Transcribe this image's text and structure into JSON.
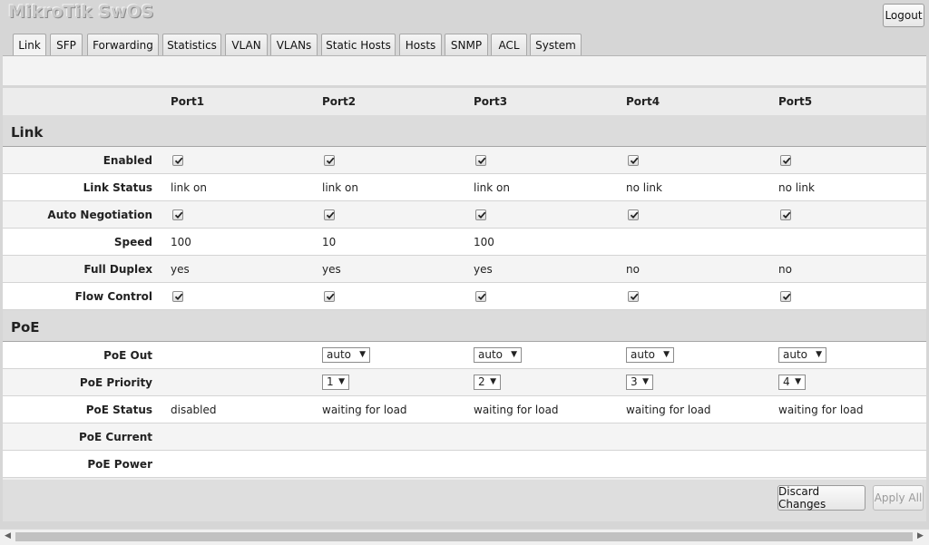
{
  "brand": "MikroTik SwOS",
  "logout_label": "Logout",
  "tabs": [
    "Link",
    "SFP",
    "Forwarding",
    "Statistics",
    "VLAN",
    "VLANs",
    "Static Hosts",
    "Hosts",
    "SNMP",
    "ACL",
    "System"
  ],
  "active_tab": "Link",
  "ports": [
    "Port1",
    "Port2",
    "Port3",
    "Port4",
    "Port5"
  ],
  "sections": {
    "link": "Link",
    "poe": "PoE"
  },
  "link": {
    "enabled": {
      "label": "Enabled",
      "values": [
        true,
        true,
        true,
        true,
        true
      ]
    },
    "link_status": {
      "label": "Link Status",
      "values": [
        "link on",
        "link on",
        "link on",
        "no link",
        "no link"
      ]
    },
    "auto_negotiation": {
      "label": "Auto Negotiation",
      "values": [
        true,
        true,
        true,
        true,
        true
      ]
    },
    "speed": {
      "label": "Speed",
      "values": [
        "100",
        "10",
        "100",
        "",
        ""
      ]
    },
    "full_duplex": {
      "label": "Full Duplex",
      "values": [
        "yes",
        "yes",
        "yes",
        "no",
        "no"
      ]
    },
    "flow_control": {
      "label": "Flow Control",
      "values": [
        true,
        true,
        true,
        true,
        true
      ]
    }
  },
  "poe": {
    "poe_out": {
      "label": "PoE Out",
      "values": [
        "",
        "auto",
        "auto",
        "auto",
        "auto"
      ]
    },
    "poe_priority": {
      "label": "PoE Priority",
      "values": [
        "",
        "1",
        "2",
        "3",
        "4"
      ]
    },
    "poe_status": {
      "label": "PoE Status",
      "values": [
        "disabled",
        "waiting for load",
        "waiting for load",
        "waiting for load",
        "waiting for load"
      ]
    },
    "poe_current": {
      "label": "PoE Current",
      "values": [
        "",
        "",
        "",
        "",
        ""
      ]
    },
    "poe_power": {
      "label": "PoE Power",
      "values": [
        "",
        "",
        "",
        "",
        ""
      ]
    }
  },
  "buttons": {
    "discard": "Discard Changes",
    "apply": "Apply All"
  }
}
